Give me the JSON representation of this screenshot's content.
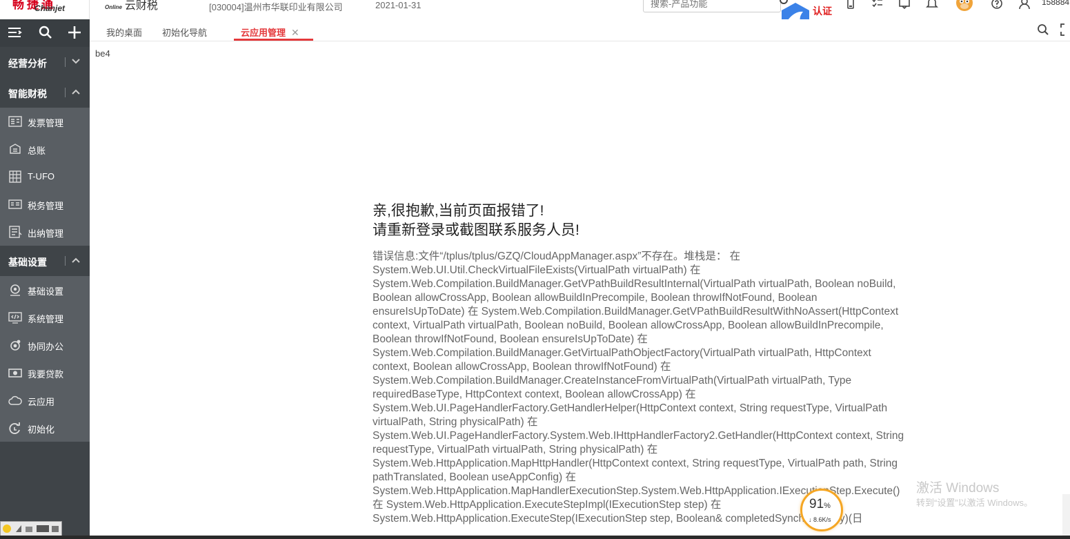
{
  "header": {
    "logo_cn": "畅捷通",
    "logo_en": "Chanjet",
    "brand_online": "Online",
    "brand_name": "云财税",
    "company": "[030004]温州市华联印业有限公司",
    "date": "2021-01-31",
    "search_placeholder": "搜索-产品功能",
    "auth_label": "认证",
    "phone": "158884"
  },
  "sidebar": {
    "groups": [
      {
        "label": "经营分析",
        "expanded": false
      },
      {
        "label": "智能财税",
        "expanded": true
      },
      {
        "label": "基础设置",
        "expanded": true
      }
    ],
    "finance_items": [
      {
        "label": "发票管理",
        "icon": "invoice-icon"
      },
      {
        "label": "总账",
        "icon": "ledger-icon"
      },
      {
        "label": "T-UFO",
        "icon": "report-icon"
      },
      {
        "label": "税务管理",
        "icon": "tax-icon"
      },
      {
        "label": "出纳管理",
        "icon": "cashier-icon"
      }
    ],
    "base_items": [
      {
        "label": "基础设置",
        "icon": "settings-icon"
      },
      {
        "label": "系统管理",
        "icon": "system-icon"
      },
      {
        "label": "协同办公",
        "icon": "collab-icon"
      },
      {
        "label": "我要贷款",
        "icon": "loan-icon"
      },
      {
        "label": "云应用",
        "icon": "cloud-icon"
      },
      {
        "label": "初始化",
        "icon": "init-icon"
      }
    ]
  },
  "tabs": [
    {
      "label": "我的桌面",
      "active": false
    },
    {
      "label": "初始化导航",
      "active": false
    },
    {
      "label": "云应用管理",
      "active": true
    }
  ],
  "content": {
    "top_text": "be4",
    "error_title_1": "亲,很抱歉,当前页面报错了!",
    "error_title_2": "请重新登录或截图联系服务人员!",
    "error_detail": "错误信息:文件“/tplus/tplus/GZQ/CloudAppManager.aspx”不存在。堆栈是： 在 System.Web.UI.Util.CheckVirtualFileExists(VirtualPath virtualPath) 在 System.Web.Compilation.BuildManager.GetVPathBuildResultInternal(VirtualPath virtualPath, Boolean noBuild, Boolean allowCrossApp, Boolean allowBuildInPrecompile, Boolean throwIfNotFound, Boolean ensureIsUpToDate) 在 System.Web.Compilation.BuildManager.GetVPathBuildResultWithNoAssert(HttpContext context, VirtualPath virtualPath, Boolean noBuild, Boolean allowCrossApp, Boolean allowBuildInPrecompile, Boolean throwIfNotFound, Boolean ensureIsUpToDate) 在 System.Web.Compilation.BuildManager.GetVirtualPathObjectFactory(VirtualPath virtualPath, HttpContext context, Boolean allowCrossApp, Boolean throwIfNotFound) 在 System.Web.Compilation.BuildManager.CreateInstanceFromVirtualPath(VirtualPath virtualPath, Type requiredBaseType, HttpContext context, Boolean allowCrossApp) 在 System.Web.UI.PageHandlerFactory.GetHandlerHelper(HttpContext context, String requestType, VirtualPath virtualPath, String physicalPath) 在 System.Web.UI.PageHandlerFactory.System.Web.IHttpHandlerFactory2.GetHandler(HttpContext context, String requestType, VirtualPath virtualPath, String physicalPath) 在 System.Web.HttpApplication.MapHttpHandler(HttpContext context, String requestType, VirtualPath path, String pathTranslated, Boolean useAppConfig) 在 System.Web.HttpApplication.MapHandlerExecutionStep.System.Web.HttpApplication.IExecutionStep.Execute() 在 System.Web.HttpApplication.ExecuteStepImpl(IExecutionStep step) 在 System.Web.HttpApplication.ExecuteStep(IExecutionStep step, Boolean& completedSynchronously)(日"
  },
  "overlay": {
    "watermark_title": "激活 Windows",
    "watermark_sub": "转到“设置”以激活 Windows。",
    "speed_pct": "91",
    "speed_unit": "%",
    "speed_net": "↓ 8.6K/s"
  },
  "colors": {
    "accent": "#e4393c",
    "sidebar_dark": "#3f4448",
    "sidebar_light": "#595e63",
    "gauge": "#f5a623"
  }
}
